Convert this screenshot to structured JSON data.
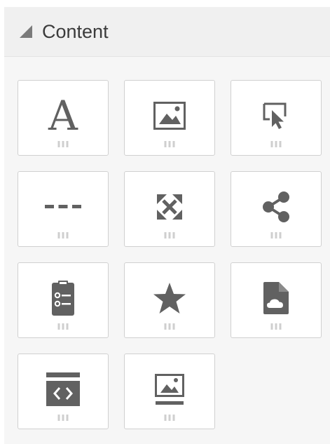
{
  "panel": {
    "title": "Content"
  },
  "tiles": [
    {
      "id": "text",
      "glyph": "A",
      "icon": "text-icon"
    },
    {
      "id": "image",
      "icon": "image-icon"
    },
    {
      "id": "button",
      "icon": "cursor-click-icon"
    },
    {
      "id": "divider",
      "icon": "divider-icon"
    },
    {
      "id": "spacer",
      "icon": "expand-arrows-icon"
    },
    {
      "id": "social",
      "icon": "share-icon"
    },
    {
      "id": "form",
      "icon": "form-icon"
    },
    {
      "id": "rating",
      "icon": "star-icon"
    },
    {
      "id": "file",
      "icon": "cloud-file-icon"
    },
    {
      "id": "html",
      "icon": "code-embed-icon"
    },
    {
      "id": "image-caption",
      "icon": "image-caption-icon"
    }
  ],
  "colors": {
    "icon": "#616161",
    "tile_border": "#d0d0d0",
    "grip": "#cfcfcf",
    "panel_bg": "#f6f6f6",
    "header_bg": "#f0f0f0"
  }
}
